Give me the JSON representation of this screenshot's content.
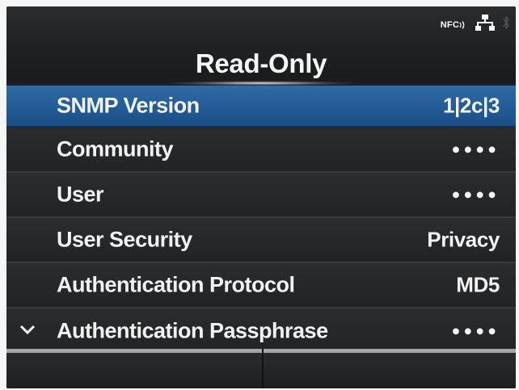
{
  "status_bar": {
    "nfc_label": "NFC",
    "icons": [
      "nfc-icon",
      "lan-icon",
      "bluetooth-icon"
    ]
  },
  "header": {
    "title": "Read-Only"
  },
  "menu": {
    "items": [
      {
        "label": "SNMP Version",
        "value": "1|2c|3",
        "selected": true
      },
      {
        "label": "Community",
        "value": "●●●●"
      },
      {
        "label": "User",
        "value": "●●●●"
      },
      {
        "label": "User Security",
        "value": "Privacy"
      },
      {
        "label": "Authentication Protocol",
        "value": "MD5"
      },
      {
        "label": "Authentication Passphrase",
        "value": "●●●●",
        "icon": "chevron-down-icon"
      }
    ]
  },
  "softkeys": {
    "left": "",
    "right": ""
  },
  "colors": {
    "background": "#1f2021",
    "selected_row": "#235b95",
    "text": "#f2f2f2"
  }
}
